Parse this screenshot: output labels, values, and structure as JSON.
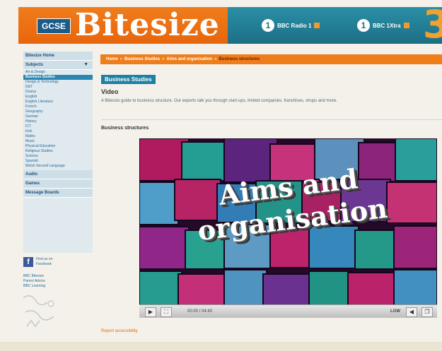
{
  "header": {
    "badge": "GCSE",
    "brand": "Bitesize",
    "radio1": "BBC Radio 1",
    "radio2": "BBC 1Xtra",
    "colors": {
      "orange": "#e8650c",
      "teal": "#1c6f85"
    }
  },
  "sidebar": {
    "home": "Bitesize Home",
    "subjects": "Subjects",
    "items": [
      "Art & Design",
      "Business Studies",
      "Design & Technology",
      "D&T",
      "Drama",
      "English",
      "English Literature",
      "French",
      "Geography",
      "German",
      "History",
      "ICT",
      "Irish",
      "Maths",
      "Music",
      "Physical Education",
      "Religious Studies",
      "Science",
      "Spanish",
      "Welsh Second Language"
    ],
    "active_index": 1,
    "sections": [
      "Audio",
      "Games",
      "Message Boards"
    ],
    "facebook_text": "Find us on Facebook",
    "links": [
      "BBC Bitesize",
      "Parent Advice",
      "BBC Learning"
    ]
  },
  "breadcrumb": [
    "Home",
    "Business Studies",
    "Aims and organisation",
    "Business structures"
  ],
  "main": {
    "section_title": "Business Studies",
    "video_label": "Video",
    "intro": "A Bitesize guide to business structure. Our experts talk you through start-ups, limited companies, franchises, shops and more.",
    "clip_title": "Business structures",
    "overlay_line1": "Aims and",
    "overlay_line2": "organisation",
    "time": "00:00 / 04:40",
    "quality": "LOW",
    "report": "Report accessibility"
  }
}
